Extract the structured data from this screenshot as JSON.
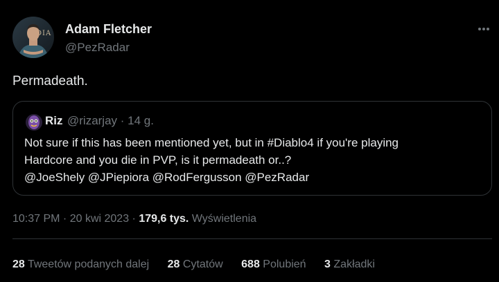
{
  "author": {
    "name": "Adam Fletcher",
    "handle": "@PezRadar",
    "avatar_text": "DIA"
  },
  "tweet": {
    "text": "Permadeath."
  },
  "quote": {
    "name": "Riz",
    "handle_time": "@rizarjay · 14 g.",
    "lines": [
      "Not sure if this has been mentioned yet, but in #Diablo4 if you're playing",
      "Hardcore and you die in PVP, is it permadeath or..?",
      "@JoeShely @JPiepiora @RodFergusson  @PezRadar"
    ]
  },
  "meta": {
    "time_date": "10:37 PM · 20 kwi 2023 · ",
    "views_count": "179,6 tys.",
    "views_label": " Wyświetlenia"
  },
  "stats": [
    {
      "num": "28",
      "label": "Tweetów podanych dalej"
    },
    {
      "num": "28",
      "label": "Cytatów"
    },
    {
      "num": "688",
      "label": "Polubień"
    },
    {
      "num": "3",
      "label": "Zakładki"
    }
  ],
  "colors": {
    "background": "#000000",
    "text": "#e7e9ea",
    "secondary_text": "#71767b",
    "border": "#2f3336"
  },
  "icons": {
    "more": "more-icon"
  }
}
